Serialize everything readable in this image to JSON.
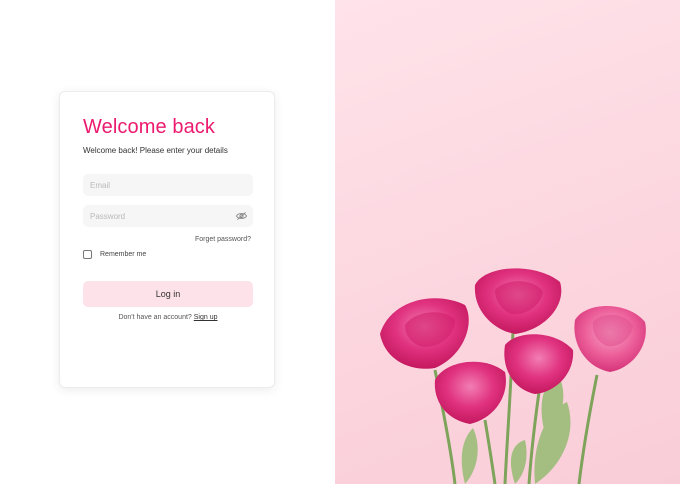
{
  "login": {
    "title": "Welcome back",
    "subtitle": "Welcome back! Please enter your details",
    "email_placeholder": "Email",
    "password_placeholder": "Password",
    "forgot_label": "Forget password?",
    "remember_label": "Remember me",
    "login_label": "Log in",
    "signup_prompt": "Don't have an account?",
    "signup_link": "Sign up"
  },
  "icons": {
    "password_toggle": "eye-off-icon",
    "hero": "pink-roses-photo"
  },
  "colors": {
    "accent": "#ec1a6f",
    "button_bg": "#fde2ea",
    "field_bg": "#f6f6f6",
    "hero_bg": "#fcd6df"
  }
}
